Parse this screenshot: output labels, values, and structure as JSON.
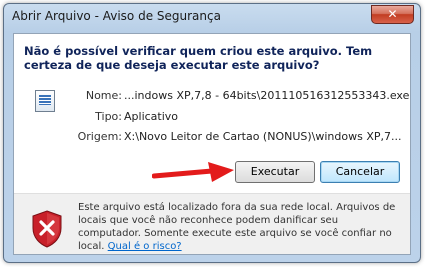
{
  "window": {
    "title": "Abrir Arquivo - Aviso de Segurança",
    "close_label": "✕"
  },
  "dialog": {
    "heading": "Não é possível verificar quem criou este arquivo. Tem certeza de que deseja executar este arquivo?",
    "name_label": "Nome:",
    "name_value": "...indows XP,7,8 - 64bits\\201110516312553343.exe",
    "type_label": "Tipo:",
    "type_value": "Aplicativo",
    "origin_label": "Origem:",
    "origin_value": "X:\\Novo Leitor de Cartao (NONUS)\\windows XP,7...",
    "run_button": "Executar",
    "cancel_button": "Cancelar"
  },
  "warning": {
    "text": "Este arquivo está localizado fora da sua rede local. Arquivos de locais que você não reconhece podem danificar seu computador. Somente execute este arquivo se você confiar no local.",
    "link": "Qual é o risco?"
  },
  "colors": {
    "heading": "#10245a",
    "arrow": "#e31b1b",
    "shield_red": "#c8202a",
    "link": "#0066cc"
  },
  "icons": [
    "close-icon",
    "application-file-icon",
    "red-arrow-icon",
    "security-shield-icon"
  ]
}
